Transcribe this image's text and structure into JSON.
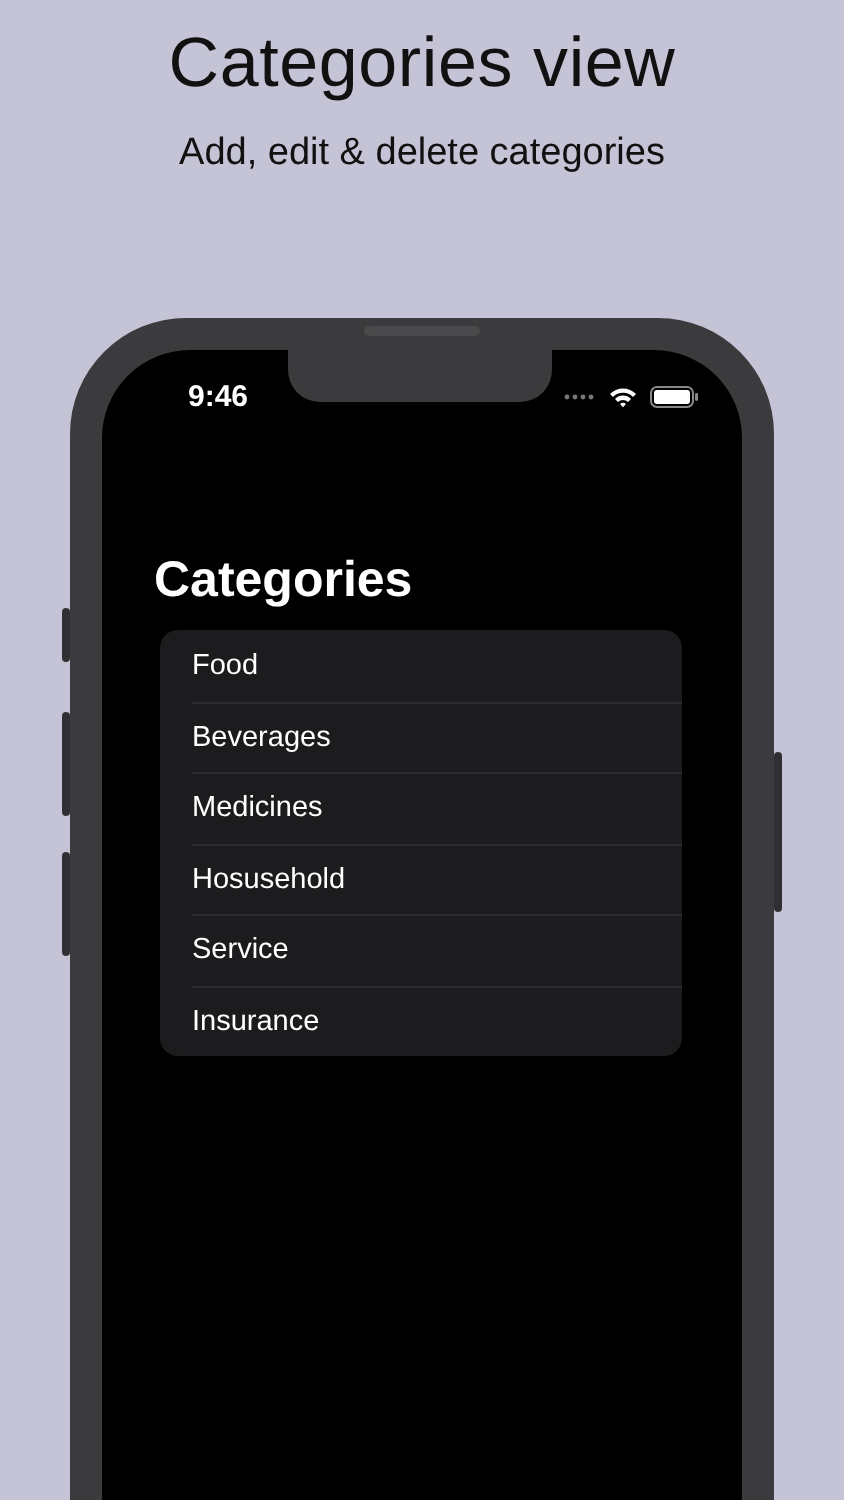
{
  "header": {
    "title": "Categories view",
    "subtitle": "Add, edit & delete categories"
  },
  "status_bar": {
    "time": "9:46"
  },
  "screen": {
    "title": "Categories",
    "categories": [
      "Food",
      "Beverages",
      "Medicines",
      "Hosusehold",
      "Service",
      "Insurance"
    ]
  }
}
